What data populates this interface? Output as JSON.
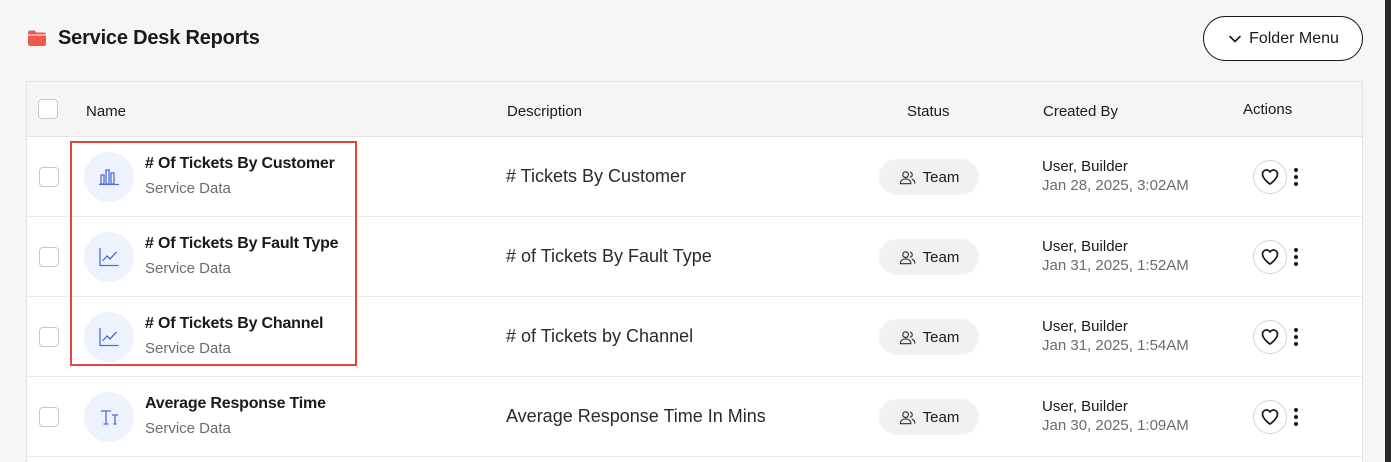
{
  "header": {
    "title": "Service Desk Reports",
    "folder_icon": "folder-icon",
    "folder_icon_color": "#f0584c",
    "folder_menu_label": "Folder Menu"
  },
  "table": {
    "columns": {
      "name": "Name",
      "description": "Description",
      "status": "Status",
      "created_by": "Created By",
      "actions": "Actions"
    },
    "rows": [
      {
        "name": "# Of Tickets By Customer",
        "subtitle": "Service Data",
        "icon": "bar-chart-icon",
        "description": "# Tickets By Customer",
        "status": "Team",
        "creator": "User, Builder",
        "created": "Jan 28, 2025, 3:02AM"
      },
      {
        "name": "# Of Tickets By Fault Type",
        "subtitle": "Service Data",
        "icon": "line-chart-icon",
        "description": "# of Tickets By Fault Type",
        "status": "Team",
        "creator": "User, Builder",
        "created": "Jan 31, 2025, 1:52AM"
      },
      {
        "name": "# Of Tickets By Channel",
        "subtitle": "Service Data",
        "icon": "line-chart-icon",
        "description": "# of Tickets by Channel",
        "status": "Team",
        "creator": "User, Builder",
        "created": "Jan 31, 2025, 1:54AM"
      },
      {
        "name": "Average Response Time",
        "subtitle": "Service Data",
        "icon": "text-height-icon",
        "description": "Average Response Time In Mins",
        "status": "Team",
        "creator": "User, Builder",
        "created": "Jan 30, 2025, 1:09AM"
      }
    ]
  },
  "colors": {
    "accent_icon": "#4a6fd8",
    "icon_bg": "#eef2fc",
    "highlight": "#e0483e"
  }
}
